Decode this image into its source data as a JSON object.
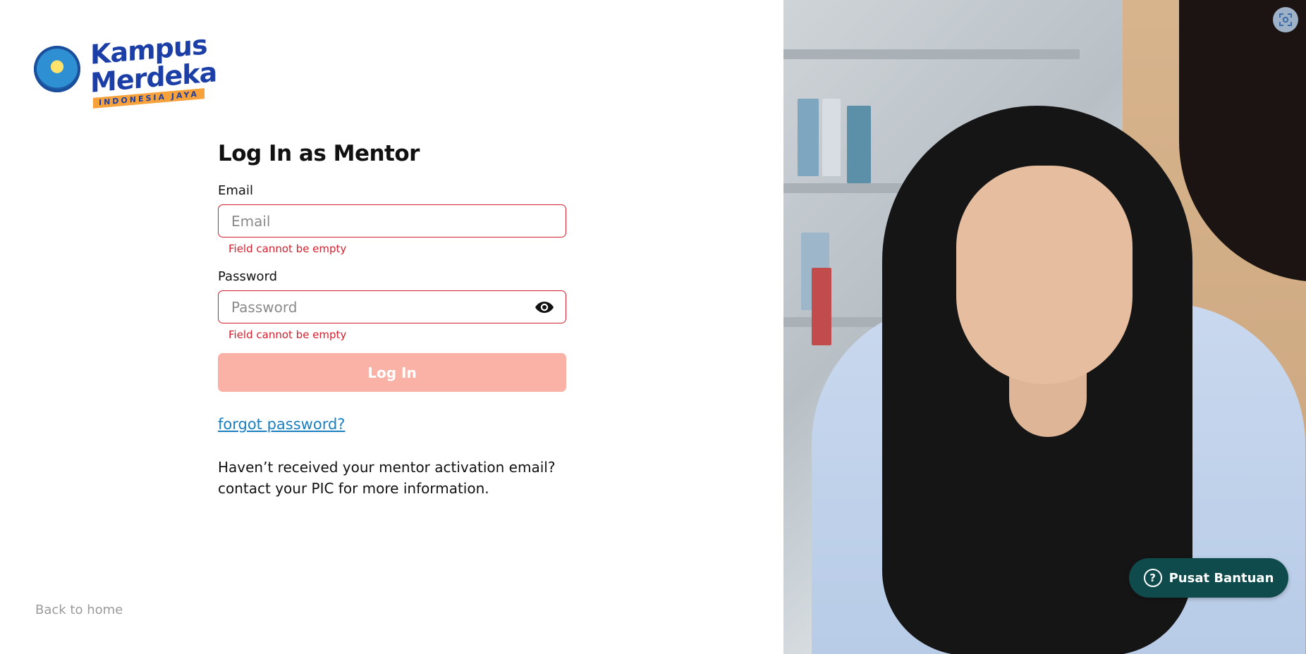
{
  "brand": {
    "logo_line1": "Kampus",
    "logo_line2": "Merdeka",
    "logo_subtitle": "INDONESIA JAYA"
  },
  "form": {
    "title": "Log In as Mentor",
    "email_label": "Email",
    "email_placeholder": "Email",
    "email_value": "",
    "email_error": "Field cannot be empty",
    "password_label": "Password",
    "password_placeholder": "Password",
    "password_value": "",
    "password_error": "Field cannot be empty",
    "login_button": "Log In",
    "forgot_link": "forgot password?",
    "note_line1": "Haven’t received your mentor activation email?",
    "note_line2": "contact your PIC for more information."
  },
  "footer": {
    "back_link": "Back to home"
  },
  "help": {
    "button_label": "Pusat Bantuan",
    "icon": "question-circle-icon"
  },
  "icons": {
    "password_toggle": "eye-icon",
    "focus": "focus-scan-icon"
  },
  "colors": {
    "error": "#d4202e",
    "login_button_bg": "#fbb2a6",
    "link": "#1a7fc1",
    "help_button_bg": "#0f4a4d",
    "brand_blue": "#1b3fa6"
  }
}
